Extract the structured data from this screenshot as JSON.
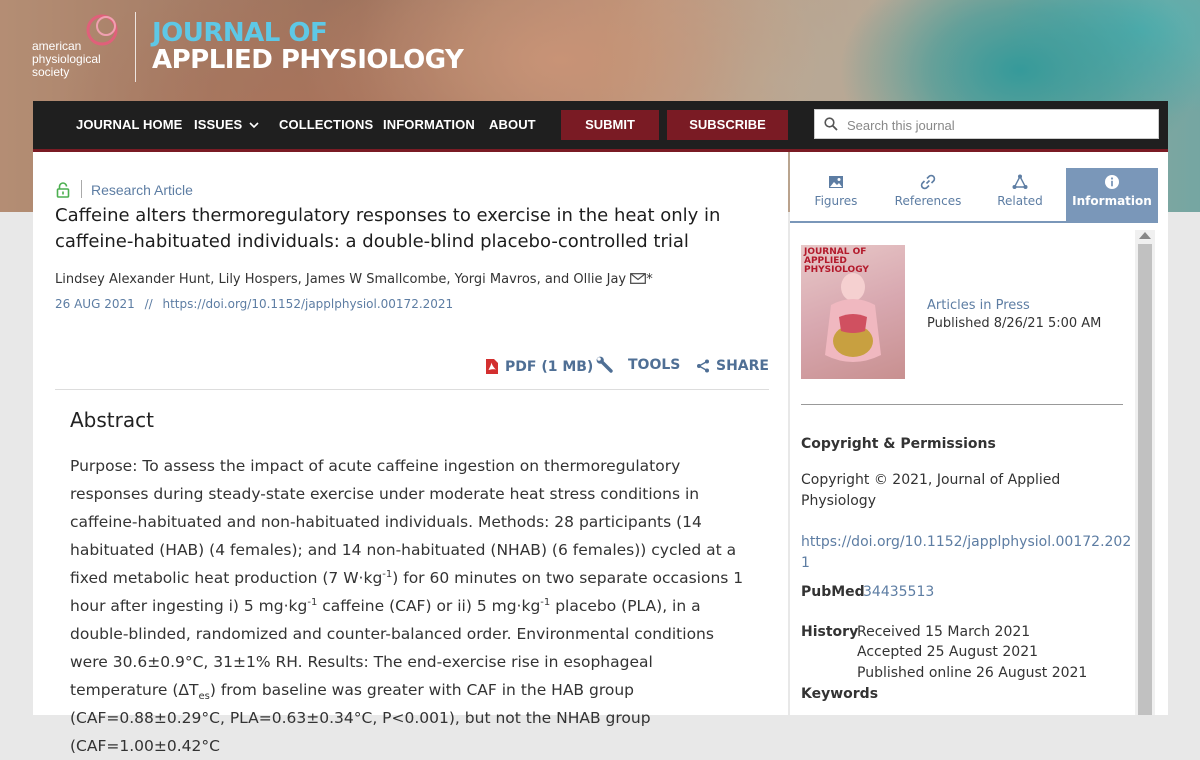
{
  "header": {
    "society_name": "american physiological society",
    "society_lines": [
      "american",
      "physiological",
      "society"
    ],
    "journal_line1": "JOURNAL OF",
    "journal_line2": "APPLIED PHYSIOLOGY"
  },
  "nav": {
    "journal_home": "JOURNAL HOME",
    "issues": "ISSUES",
    "collections": "COLLECTIONS",
    "information": "INFORMATION",
    "about": "ABOUT",
    "submit": "SUBMIT",
    "subscribe": "SUBSCRIBE",
    "search_placeholder": "Search this journal"
  },
  "article": {
    "type": "Research Article",
    "title": "Caffeine alters thermoregulatory responses to exercise in the heat only in caffeine-habituated individuals: a double-blind placebo-controlled trial",
    "authors": "Lindsey Alexander Hunt, Lily Hospers, James W Smallcombe, Yorgi Mavros, and Ollie Jay",
    "corresponding_mark": "*",
    "date": "26 AUG 2021",
    "date_sep": "//",
    "doi": "https://doi.org/10.1152/japplphysiol.00172.2021",
    "pdf_label": "PDF (1 MB)",
    "tools_label": "TOOLS",
    "share_label": "SHARE",
    "abstract_heading": "Abstract",
    "abstract": {
      "t1": "Purpose: To assess the impact of acute caffeine ingestion on thermoregulatory responses during steady-state exercise under moderate heat stress conditions in caffeine-habituated and non-habituated individuals. Methods: 28 participants (14 habituated (HAB) (4 females); and 14 non-habituated (NHAB) (6 females)) cycled at a fixed metabolic heat production (7 W·kg",
      "s1": "-1",
      "t2": ") for 60 minutes on two separate occasions 1 hour after ingesting i) 5 mg·kg",
      "s2": "-1",
      "t3": " caffeine (CAF) or ii) 5 mg·kg",
      "s3": "-1",
      "t4": " placebo (PLA), in a double-blinded, randomized and counter-balanced order. Environmental conditions were 30.6±0.9°C, 31±1% RH. Results: The end-exercise rise in esophageal temperature (ΔT",
      "sub1": "es",
      "t5": ") from baseline was greater with CAF in the HAB group (CAF=0.88±0.29°C, PLA=0.63±0.34°C, P<0.001), but not the NHAB group (CAF=1.00±0.42°C"
    }
  },
  "sidebar": {
    "tabs": [
      {
        "label": "Figures"
      },
      {
        "label": "References"
      },
      {
        "label": "Related"
      },
      {
        "label": "Information"
      }
    ],
    "cover_title": "JOURNAL OF APPLIED PHYSIOLOGY",
    "articles_in_press": "Articles in Press",
    "published": "Published 8/26/21 5:00 AM",
    "copyright_heading": "Copyright & Permissions",
    "copyright_text": "Copyright © 2021, Journal of Applied Physiology",
    "doi_line1": "https://doi.org/10.1152/japplphysiol.00172.202",
    "doi_line2": "1",
    "pubmed_label": "PubMed",
    "pubmed_id": "34435513",
    "history_label": "History",
    "received": "Received 15 March 2021",
    "accepted": "Accepted 25 August 2021",
    "published_online": "Published online 26 August 2021",
    "keywords_label": "Keywords"
  },
  "colors": {
    "nav_bg": "#1f1f1f",
    "accent_maroon": "#7a1b24",
    "link_blue": "#5d7da3",
    "tab_active": "#7a97b9",
    "journal_cyan": "#5ec8e6"
  }
}
